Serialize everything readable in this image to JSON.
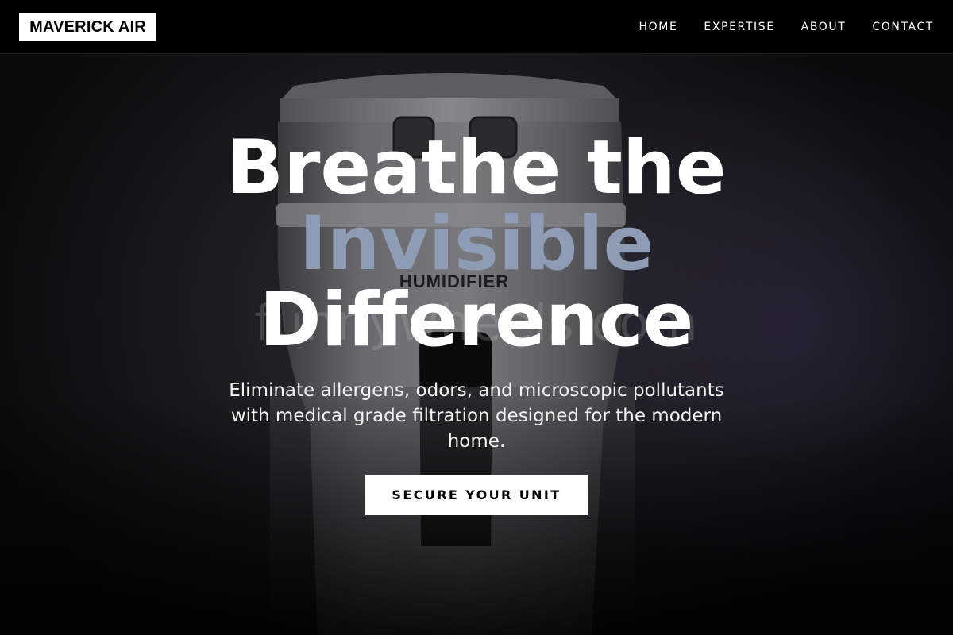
{
  "brand": {
    "logo_text": "MAVERICK AIR"
  },
  "nav": {
    "items": [
      {
        "label": "HOME"
      },
      {
        "label": "EXPERTISE"
      },
      {
        "label": "ABOUT"
      },
      {
        "label": "CONTACT"
      }
    ]
  },
  "hero": {
    "headline_line1": "Breathe the",
    "headline_line2": "Invisible",
    "headline_line3": "Difference",
    "subtext": "Eliminate allergens, odors, and microscopic pollutants with medical grade filtration designed for the modern home.",
    "cta_label": "SECURE YOUR UNIT",
    "image": {
      "product_label": "HUMIDIFIER",
      "watermark_text": "funnywheels.com"
    }
  },
  "colors": {
    "nav_background": "#000000",
    "logo_background": "#ffffff",
    "headline_accent": "#8e9cb5",
    "cta_background": "#ffffff"
  }
}
